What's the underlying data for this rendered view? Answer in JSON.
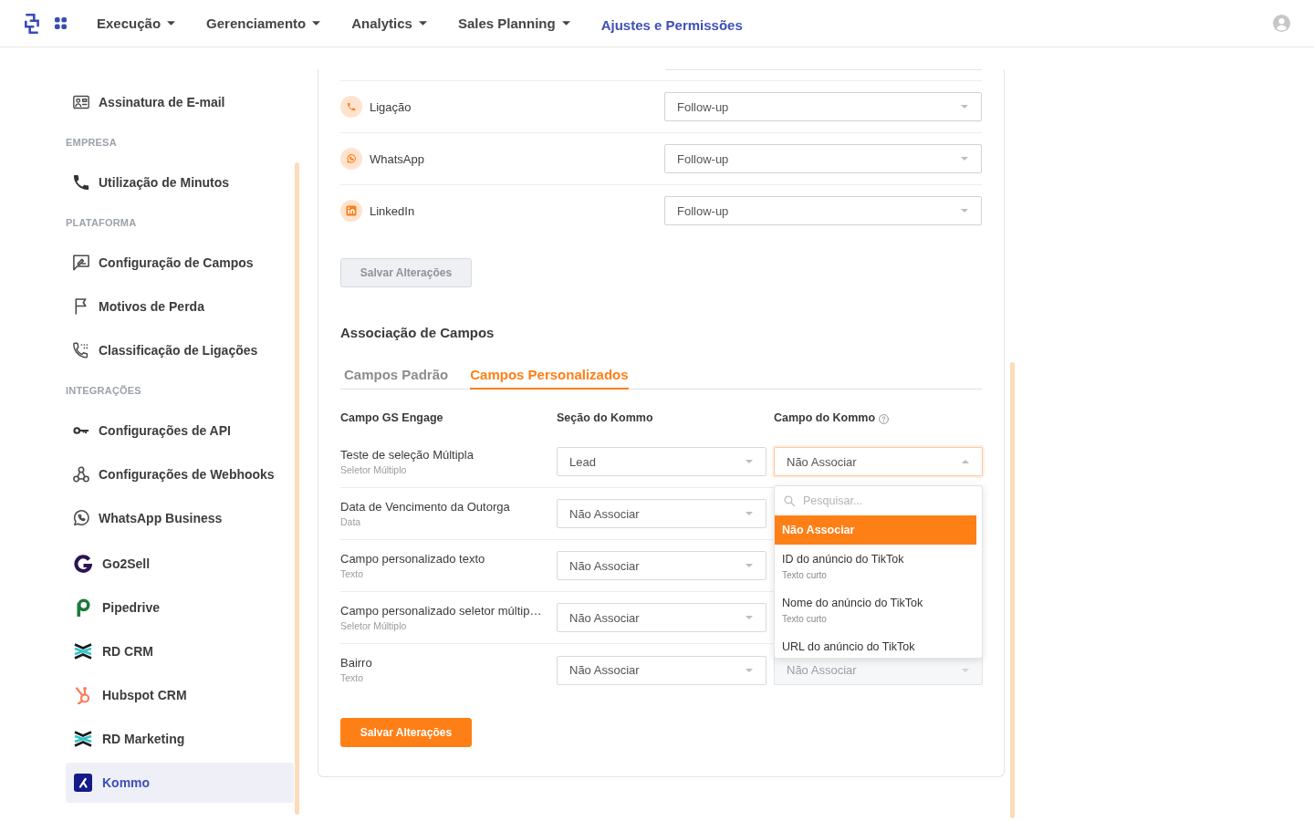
{
  "top_nav": {
    "items": [
      {
        "label": "Execução",
        "menu": true,
        "selected": false
      },
      {
        "label": "Gerenciamento",
        "menu": true,
        "selected": false
      },
      {
        "label": "Analytics",
        "menu": true,
        "selected": false
      },
      {
        "label": "Sales Planning",
        "menu": true,
        "selected": false
      },
      {
        "label": "Ajustes e Permissões",
        "menu": false,
        "selected": true
      }
    ]
  },
  "sidebar": {
    "groups": [
      {
        "items": [
          {
            "label": "Assinatura de E-mail",
            "kind": "icon",
            "selected": false
          }
        ]
      },
      {
        "heading": "EMPRESA",
        "items": [
          {
            "label": "Utilização de Minutos",
            "kind": "icon",
            "selected": false
          }
        ]
      },
      {
        "heading": "PLATAFORMA",
        "items": [
          {
            "label": "Configuração de Campos",
            "kind": "icon",
            "selected": false
          },
          {
            "label": "Motivos de Perda",
            "kind": "icon",
            "selected": false
          },
          {
            "label": "Classificação de Ligações",
            "kind": "icon",
            "selected": false
          }
        ]
      },
      {
        "heading": "INTEGRAÇÕES",
        "items": [
          {
            "label": "Configurações de API",
            "kind": "icon",
            "selected": false
          },
          {
            "label": "Configurações de Webhooks",
            "kind": "icon",
            "selected": false
          },
          {
            "label": "WhatsApp Business",
            "kind": "icon",
            "selected": false
          },
          {
            "label": "Go2Sell",
            "kind": "logo",
            "selected": false
          },
          {
            "label": "Pipedrive",
            "kind": "logo",
            "selected": false
          },
          {
            "label": "RD CRM",
            "kind": "logo",
            "selected": false
          },
          {
            "label": "Hubspot CRM",
            "kind": "logo",
            "selected": false
          },
          {
            "label": "RD Marketing",
            "kind": "logo",
            "selected": false
          },
          {
            "label": "Kommo",
            "kind": "logo",
            "selected": true
          }
        ]
      }
    ]
  },
  "channels": {
    "rows": [
      {
        "label": "Ligação",
        "value": "Follow-up"
      },
      {
        "label": "WhatsApp",
        "value": "Follow-up"
      },
      {
        "label": "LinkedIn",
        "value": "Follow-up"
      }
    ],
    "save_button": {
      "label": "Salvar Alterações",
      "disabled": true
    }
  },
  "association": {
    "title": "Associação de Campos",
    "tabs": [
      {
        "label": "Campos Padrão",
        "selected": false
      },
      {
        "label": "Campos Personalizados",
        "selected": true
      }
    ],
    "columns": [
      {
        "label": "Campo GS Engage",
        "help": false
      },
      {
        "label": "Seção do Kommo",
        "help": false
      },
      {
        "label": "Campo do Kommo",
        "help": true
      }
    ],
    "rows": [
      {
        "name": "Teste de seleção Múltipla",
        "type": "Seletor Múltiplo",
        "section": {
          "value": "Lead"
        },
        "field": {
          "value": "Não Associar",
          "open": true,
          "disabled": false
        }
      },
      {
        "name": "Data de Vencimento da Outorga",
        "type": "Data",
        "section": {
          "value": "Não Associar"
        }
      },
      {
        "name": "Campo personalizado texto",
        "type": "Texto",
        "section": {
          "value": "Não Associar"
        }
      },
      {
        "name": "Campo personalizado seletor múltip…",
        "type": "Seletor Múltiplo",
        "section": {
          "value": "Não Associar"
        }
      },
      {
        "name": "Bairro",
        "type": "Texto",
        "section": {
          "value": "Não Associar"
        },
        "field": {
          "value": "Não Associar",
          "open": false,
          "disabled": true
        }
      }
    ],
    "dropdown": {
      "placeholder": "Pesquisar...",
      "options": [
        {
          "label": "Não Associar",
          "selected": true
        },
        {
          "label": "ID do anúncio do TikTok",
          "detail": "Texto curto",
          "selected": false
        },
        {
          "label": "Nome do anúncio do TikTok",
          "detail": "Texto curto",
          "selected": false
        },
        {
          "label": "URL do anúncio do TikTok",
          "selected": false
        }
      ]
    },
    "save_button": {
      "label": "Salvar Alterações",
      "disabled": false
    }
  }
}
